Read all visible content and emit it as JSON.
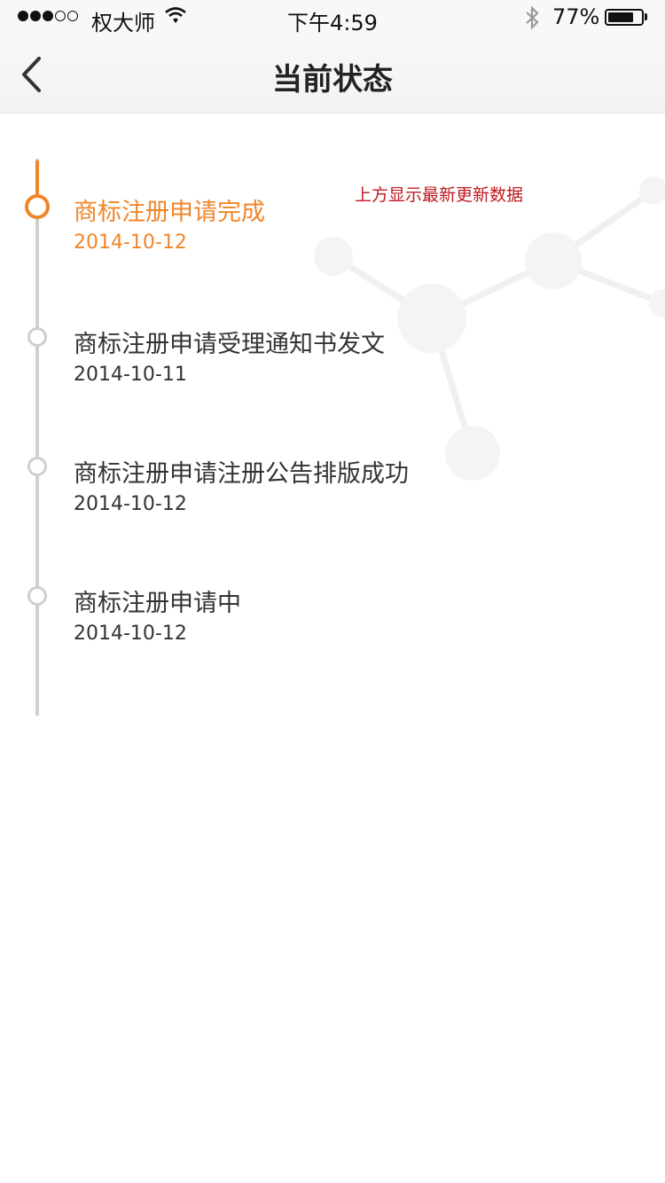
{
  "status_bar": {
    "carrier": "权大师",
    "time": "下午4:59",
    "battery_percent": "77%",
    "battery_level": 0.77,
    "signal_bars_filled": 3,
    "signal_bars_total": 5
  },
  "nav": {
    "title": "当前状态",
    "back_icon": "chevron-left-icon"
  },
  "note": "上方显示最新更新数据",
  "timeline": [
    {
      "title": "商标注册申请完成",
      "date": "2014-10-12",
      "active": true
    },
    {
      "title": "商标注册申请受理通知书发文",
      "date": "2014-10-11",
      "active": false
    },
    {
      "title": "商标注册申请注册公告排版成功",
      "date": "2014-10-12",
      "active": false
    },
    {
      "title": "商标注册申请中",
      "date": "2014-10-12",
      "active": false
    }
  ],
  "colors": {
    "accent": "#f0862a",
    "line": "#d0d0d0",
    "note": "#c0181f"
  }
}
